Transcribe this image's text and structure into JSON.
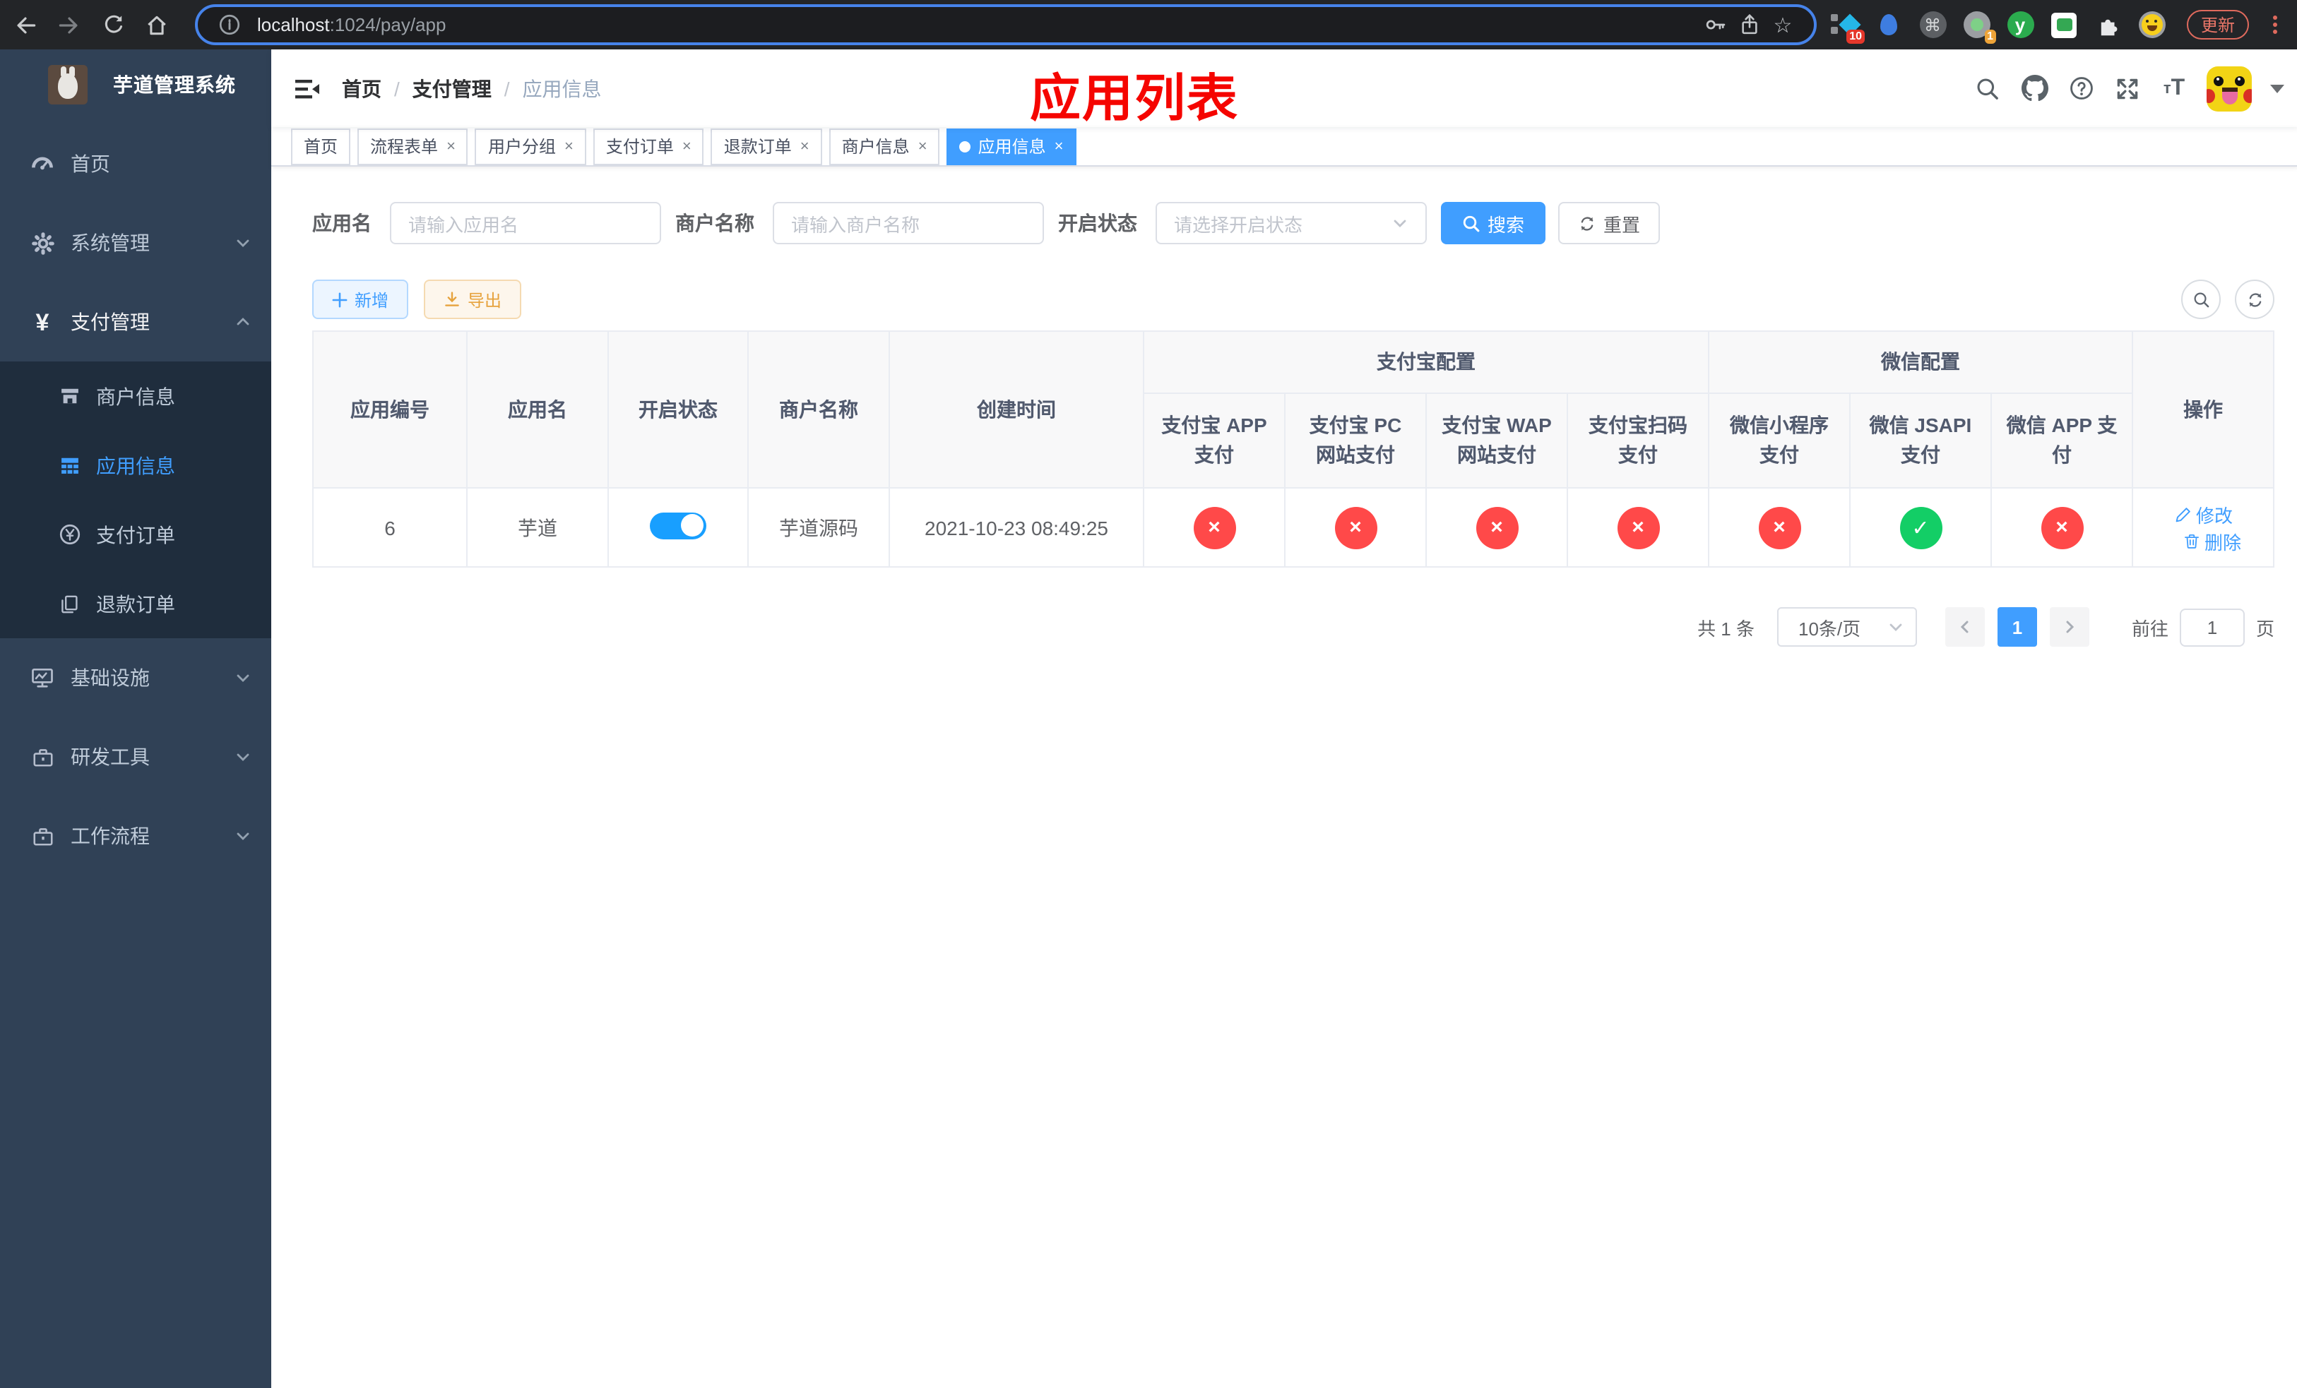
{
  "browser": {
    "url_host": "localhost",
    "url_path": ":1024/pay/app",
    "star_glyph": "☆",
    "command_glyph": "⌘",
    "y_glyph": "y",
    "ext_badge_tasks": "10",
    "ext_badge_recorder": "1",
    "update_label": "更新"
  },
  "sidebar": {
    "title": "芋道管理系统",
    "yen_glyph": "¥",
    "items": [
      {
        "label": "首页"
      },
      {
        "label": "系统管理"
      },
      {
        "label": "支付管理"
      },
      {
        "label": "商户信息"
      },
      {
        "label": "应用信息"
      },
      {
        "label": "支付订单"
      },
      {
        "label": "退款订单"
      },
      {
        "label": "基础设施"
      },
      {
        "label": "研发工具"
      },
      {
        "label": "工作流程"
      }
    ]
  },
  "navbar": {
    "breadcrumb": [
      "首页",
      "支付管理",
      "应用信息"
    ],
    "separator": "/",
    "annotation": "应用列表",
    "font_icon_small": "т",
    "font_icon_big": "T"
  },
  "tags": {
    "close_glyph": "×",
    "items": [
      {
        "label": "首页"
      },
      {
        "label": "流程表单"
      },
      {
        "label": "用户分组"
      },
      {
        "label": "支付订单"
      },
      {
        "label": "退款订单"
      },
      {
        "label": "商户信息"
      },
      {
        "label": "应用信息"
      }
    ]
  },
  "filters": {
    "name_label": "应用名",
    "name_placeholder": "请输入应用名",
    "merchant_label": "商户名称",
    "merchant_placeholder": "请输入商户名称",
    "status_label": "开启状态",
    "status_placeholder": "请选择开启状态",
    "search_label": "搜索",
    "reset_label": "重置"
  },
  "toolbar": {
    "add_label": "新增",
    "export_label": "导出"
  },
  "table": {
    "headers": {
      "app_id": "应用编号",
      "app_name": "应用名",
      "status": "开启状态",
      "merchant": "商户名称",
      "created": "创建时间",
      "alipay_group": "支付宝配置",
      "wechat_group": "微信配置",
      "actions": "操作",
      "sub": [
        "支付宝 APP 支付",
        "支付宝 PC 网站支付",
        "支付宝 WAP 网站支付",
        "支付宝扫码支付",
        "微信小程序支付",
        "微信 JSAPI 支付",
        "微信 APP 支付"
      ]
    },
    "row": {
      "app_id": "6",
      "app_name": "芋道",
      "merchant": "芋道源码",
      "created": "2021-10-23 08:49:25",
      "channels": [
        {
          "state": "disabled",
          "glyph": "×"
        },
        {
          "state": "disabled",
          "glyph": "×"
        },
        {
          "state": "disabled",
          "glyph": "×"
        },
        {
          "state": "disabled",
          "glyph": "×"
        },
        {
          "state": "disabled",
          "glyph": "×"
        },
        {
          "state": "enabled",
          "glyph": "✓"
        },
        {
          "state": "disabled",
          "glyph": "×"
        }
      ],
      "edit_label": "修改",
      "delete_label": "删除"
    }
  },
  "pagination": {
    "total": "共 1 条",
    "page_size": "10条/页",
    "page": "1",
    "goto_label": "前往",
    "goto_value": "1",
    "unit_label": "页"
  },
  "colors": {
    "accent": "#409eff",
    "enabled": "#13ce66",
    "disabled": "#ff4949",
    "switch_on": "#189fff",
    "annotation_red": "#f50500"
  }
}
